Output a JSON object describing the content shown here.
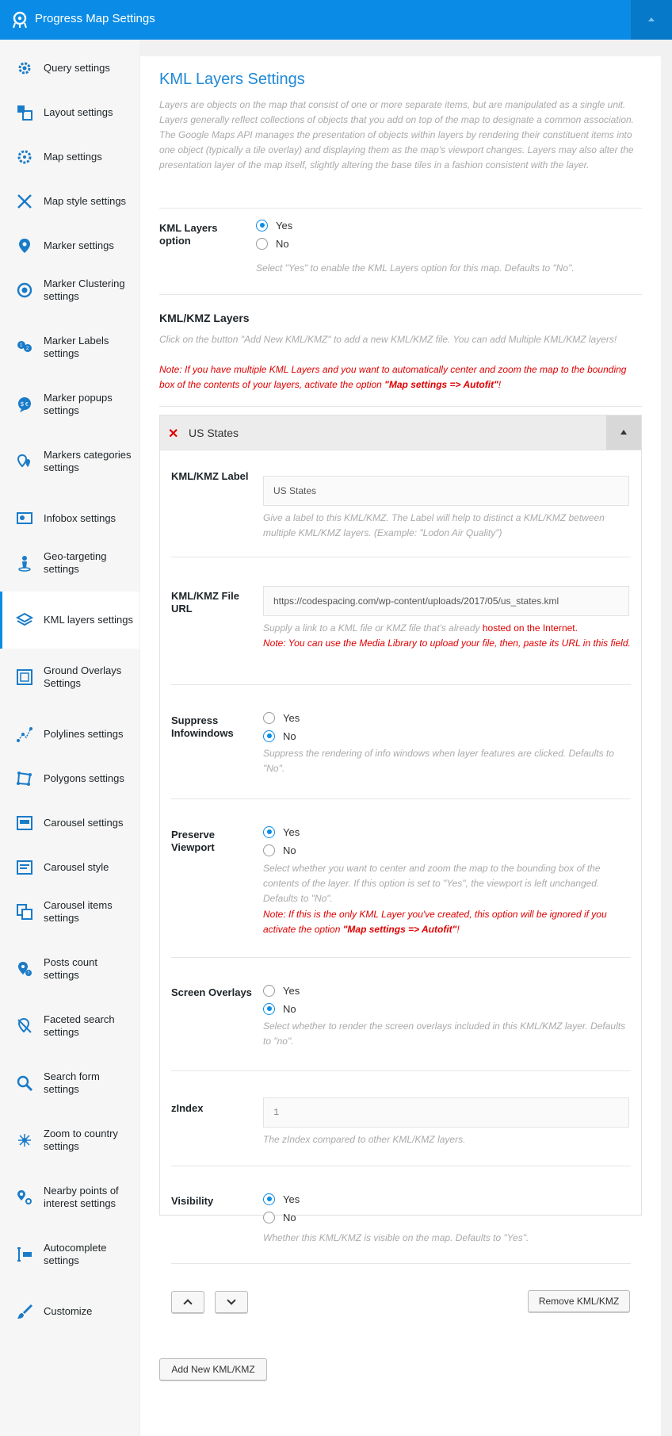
{
  "header": {
    "title": "Progress Map Settings"
  },
  "sidebar": {
    "items": [
      {
        "label": "Query settings",
        "icon": "gear-icon"
      },
      {
        "label": "Layout settings",
        "icon": "layout-icon"
      },
      {
        "label": "Map settings",
        "icon": "map-gear-icon"
      },
      {
        "label": "Map style settings",
        "icon": "map-style-icon"
      },
      {
        "label": "Marker settings",
        "icon": "marker-icon"
      },
      {
        "label": "Marker Clustering settings",
        "icon": "cluster-icon"
      },
      {
        "label": "Marker Labels settings",
        "icon": "marker-labels-icon"
      },
      {
        "label": "Marker popups settings",
        "icon": "popup-icon"
      },
      {
        "label": "Markers categories settings",
        "icon": "categories-icon"
      },
      {
        "label": "Infobox settings",
        "icon": "infobox-icon"
      },
      {
        "label": "Geo-targeting settings",
        "icon": "geo-targeting-icon"
      },
      {
        "label": "KML layers settings",
        "icon": "layers-icon"
      },
      {
        "label": "Ground Overlays Settings",
        "icon": "ground-overlay-icon"
      },
      {
        "label": "Polylines settings",
        "icon": "polyline-icon"
      },
      {
        "label": "Polygons settings",
        "icon": "polygon-icon"
      },
      {
        "label": "Carousel settings",
        "icon": "carousel-icon"
      },
      {
        "label": "Carousel style",
        "icon": "carousel-style-icon"
      },
      {
        "label": "Carousel items settings",
        "icon": "carousel-items-icon"
      },
      {
        "label": "Posts count settings",
        "icon": "posts-count-icon"
      },
      {
        "label": "Faceted search settings",
        "icon": "faceted-search-icon"
      },
      {
        "label": "Search form settings",
        "icon": "search-icon"
      },
      {
        "label": "Zoom to country settings",
        "icon": "zoom-country-icon"
      },
      {
        "label": "Nearby points of interest settings",
        "icon": "nearby-poi-icon"
      },
      {
        "label": "Autocomplete settings",
        "icon": "autocomplete-icon"
      },
      {
        "label": "Customize",
        "icon": "brush-icon"
      }
    ],
    "active_index": 11
  },
  "main": {
    "title": "KML Layers Settings",
    "description": "Layers are objects on the map that consist of one or more separate items, but are manipulated as a single unit. Layers generally reflect collections of objects that you add on top of the map to designate a common association. The Google Maps API manages the presentation of objects within layers by rendering their constituent items into one object (typically a tile overlay) and displaying them as the map's viewport changes. Layers may also alter the presentation layer of the map itself, slightly altering the base tiles in a fashion consistent with the layer.",
    "kml_option": {
      "label": "KML Layers option",
      "yes": "Yes",
      "no": "No",
      "selected": "Yes",
      "help": "Select \"Yes\" to enable the KML Layers option for this map. Defaults to \"No\"."
    },
    "kml_layers": {
      "label": "KML/KMZ Layers",
      "help": "Click on the button \"Add New KML/KMZ\" to add a new KML/KMZ file. You can add Multiple KML/KMZ layers!",
      "note_prefix": "Note: If you have multiple KML Layers and you want to automatically center and zoom the map to the bounding box of the contents of your layers, activate the option ",
      "note_bold": "\"Map settings => Autofit\"",
      "note_suffix": "!"
    },
    "layer": {
      "title": "US States",
      "label_field": {
        "label": "KML/KMZ Label",
        "value": "US States",
        "help": "Give a label to this KML/KMZ. The Label will help to distinct a KML/KMZ between multiple KML/KMZ layers. (Example: \"Lodon Air Quality\")"
      },
      "url_field": {
        "label": "KML/KMZ File URL",
        "value": "https://codespacing.com/wp-content/uploads/2017/05/us_states.kml",
        "help_prefix": "Supply a link to a KML file or KMZ file that's already ",
        "help_red": "hosted on the Internet.",
        "note": "Note: You can use the Media Library to upload your file, then, paste its URL in this field."
      },
      "suppress": {
        "label": "Suppress Infowindows",
        "yes": "Yes",
        "no": "No",
        "selected": "No",
        "help": "Suppress the rendering of info windows when layer features are clicked. Defaults to \"No\"."
      },
      "preserve": {
        "label": "Preserve Viewport",
        "yes": "Yes",
        "no": "No",
        "selected": "Yes",
        "help": "Select whether you want to center and zoom the map to the bounding box of the contents of the layer. If this option is set to \"Yes\", the viewport is left unchanged. Defaults to \"No\".",
        "note_prefix": "Note: If this is the only KML Layer you've created, this option will be ignored if you activate the option ",
        "note_bold": "\"Map settings => Autofit\"",
        "note_suffix": "!"
      },
      "screen_overlays": {
        "label": "Screen Overlays",
        "yes": "Yes",
        "no": "No",
        "selected": "No",
        "help": "Select whether to render the screen overlays included in this KML/KMZ layer. Defaults to \"no\"."
      },
      "zindex": {
        "label": "zIndex",
        "value": "1",
        "help": "The zIndex compared to other KML/KMZ layers."
      },
      "visibility": {
        "label": "Visibility",
        "yes": "Yes",
        "no": "No",
        "selected": "Yes",
        "help": "Whether this KML/KMZ is visible on the map. Defaults to \"Yes\"."
      },
      "remove_label": "Remove KML/KMZ"
    },
    "add_label": "Add New KML/KMZ"
  },
  "colors": {
    "accent": "#0a8ce6",
    "note": "#e00000"
  }
}
